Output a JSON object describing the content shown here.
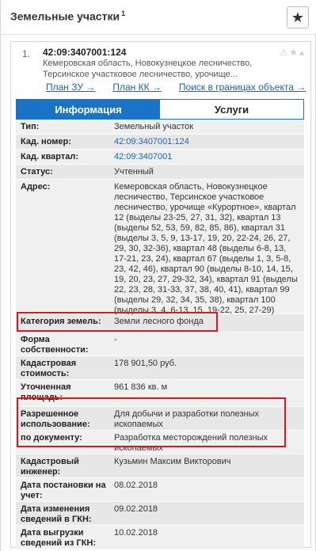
{
  "header": {
    "title": "Земельные участки",
    "sup": "1",
    "star_icon": "star-icon"
  },
  "item": {
    "number": "1.",
    "cadastral_id": "42:09:3407001:124",
    "address_short": "Кемеровская область, Новокузнецкое лесничество, Терсинское участковое лесничество, урочище..."
  },
  "links": [
    "План ЗУ →",
    "План КК →",
    "Поиск в границах объекта →"
  ],
  "tabs": [
    "Информация",
    "Услуги"
  ],
  "rows": [
    {
      "label": "Тип:",
      "value": "Земельный участок"
    },
    {
      "label": "Кад. номер:",
      "value": "42:09:3407001:124"
    },
    {
      "label": "Кад. квартал:",
      "value": "42:09:3407001"
    },
    {
      "label": "Статус:",
      "value": "Учтенный"
    },
    {
      "label": "Адрес:",
      "value": "Кемеровская область, Новокузнецкое лесничество, Терсинское участковое лесничество, урочище «Курортное», квартал 12 (выделы 23-25, 27, 31, 32), квартал 13 (выделы 52, 53, 59, 82, 85, 86), квартал 31 (выделы 3, 5, 9, 13-17, 19, 20, 22-24, 26, 27, 29, 30, 32-36), квартал 48 (выделы 6-8, 13, 17-21, 23, 24), квартал 67 (выделы 1, 3, 5-8, 23, 42, 46), квартал 90 (выделы 8-10, 14, 15, 19, 20, 23, 27, 29-32, 34), квартал 91 (выделы 22, 23, 28, 31-33, 37, 38, 40, 41), квартал 99 (выделы 29, 32, 34, 35, 38), квартал 100 (выделы 3, 4, 6-13, 15, 19-22, 25, 27-29)"
    },
    {
      "label": "Категория земель:",
      "value": "Земли лесного фонда"
    },
    {
      "label": "Форма собственности:",
      "value": "-"
    },
    {
      "label": "Кадастровая стоимость:",
      "value": "178 901,50 руб."
    },
    {
      "label": "Уточненная площадь:",
      "value": "961 836 кв. м"
    },
    {
      "label": "Разрешенное использование:",
      "value": "Для добычи и разработки полезных ископаемых"
    },
    {
      "label": "по документу:",
      "value": "Разработка месторождений полезных ископаемых"
    },
    {
      "label": "Кадастровый инженер:",
      "value": "Кузьмин Максим Викторович"
    },
    {
      "label": "Дата постановки на учет:",
      "value": "08.02.2018"
    },
    {
      "label": "Дата изменения сведений в ГКН:",
      "value": "09.02.2018"
    },
    {
      "label": "Дата выгрузки сведений из ГКН:",
      "value": "10.02.2018"
    }
  ],
  "colors": {
    "accent": "#1a73c7",
    "highlight": "#e8121b",
    "link": "#1565c0"
  }
}
